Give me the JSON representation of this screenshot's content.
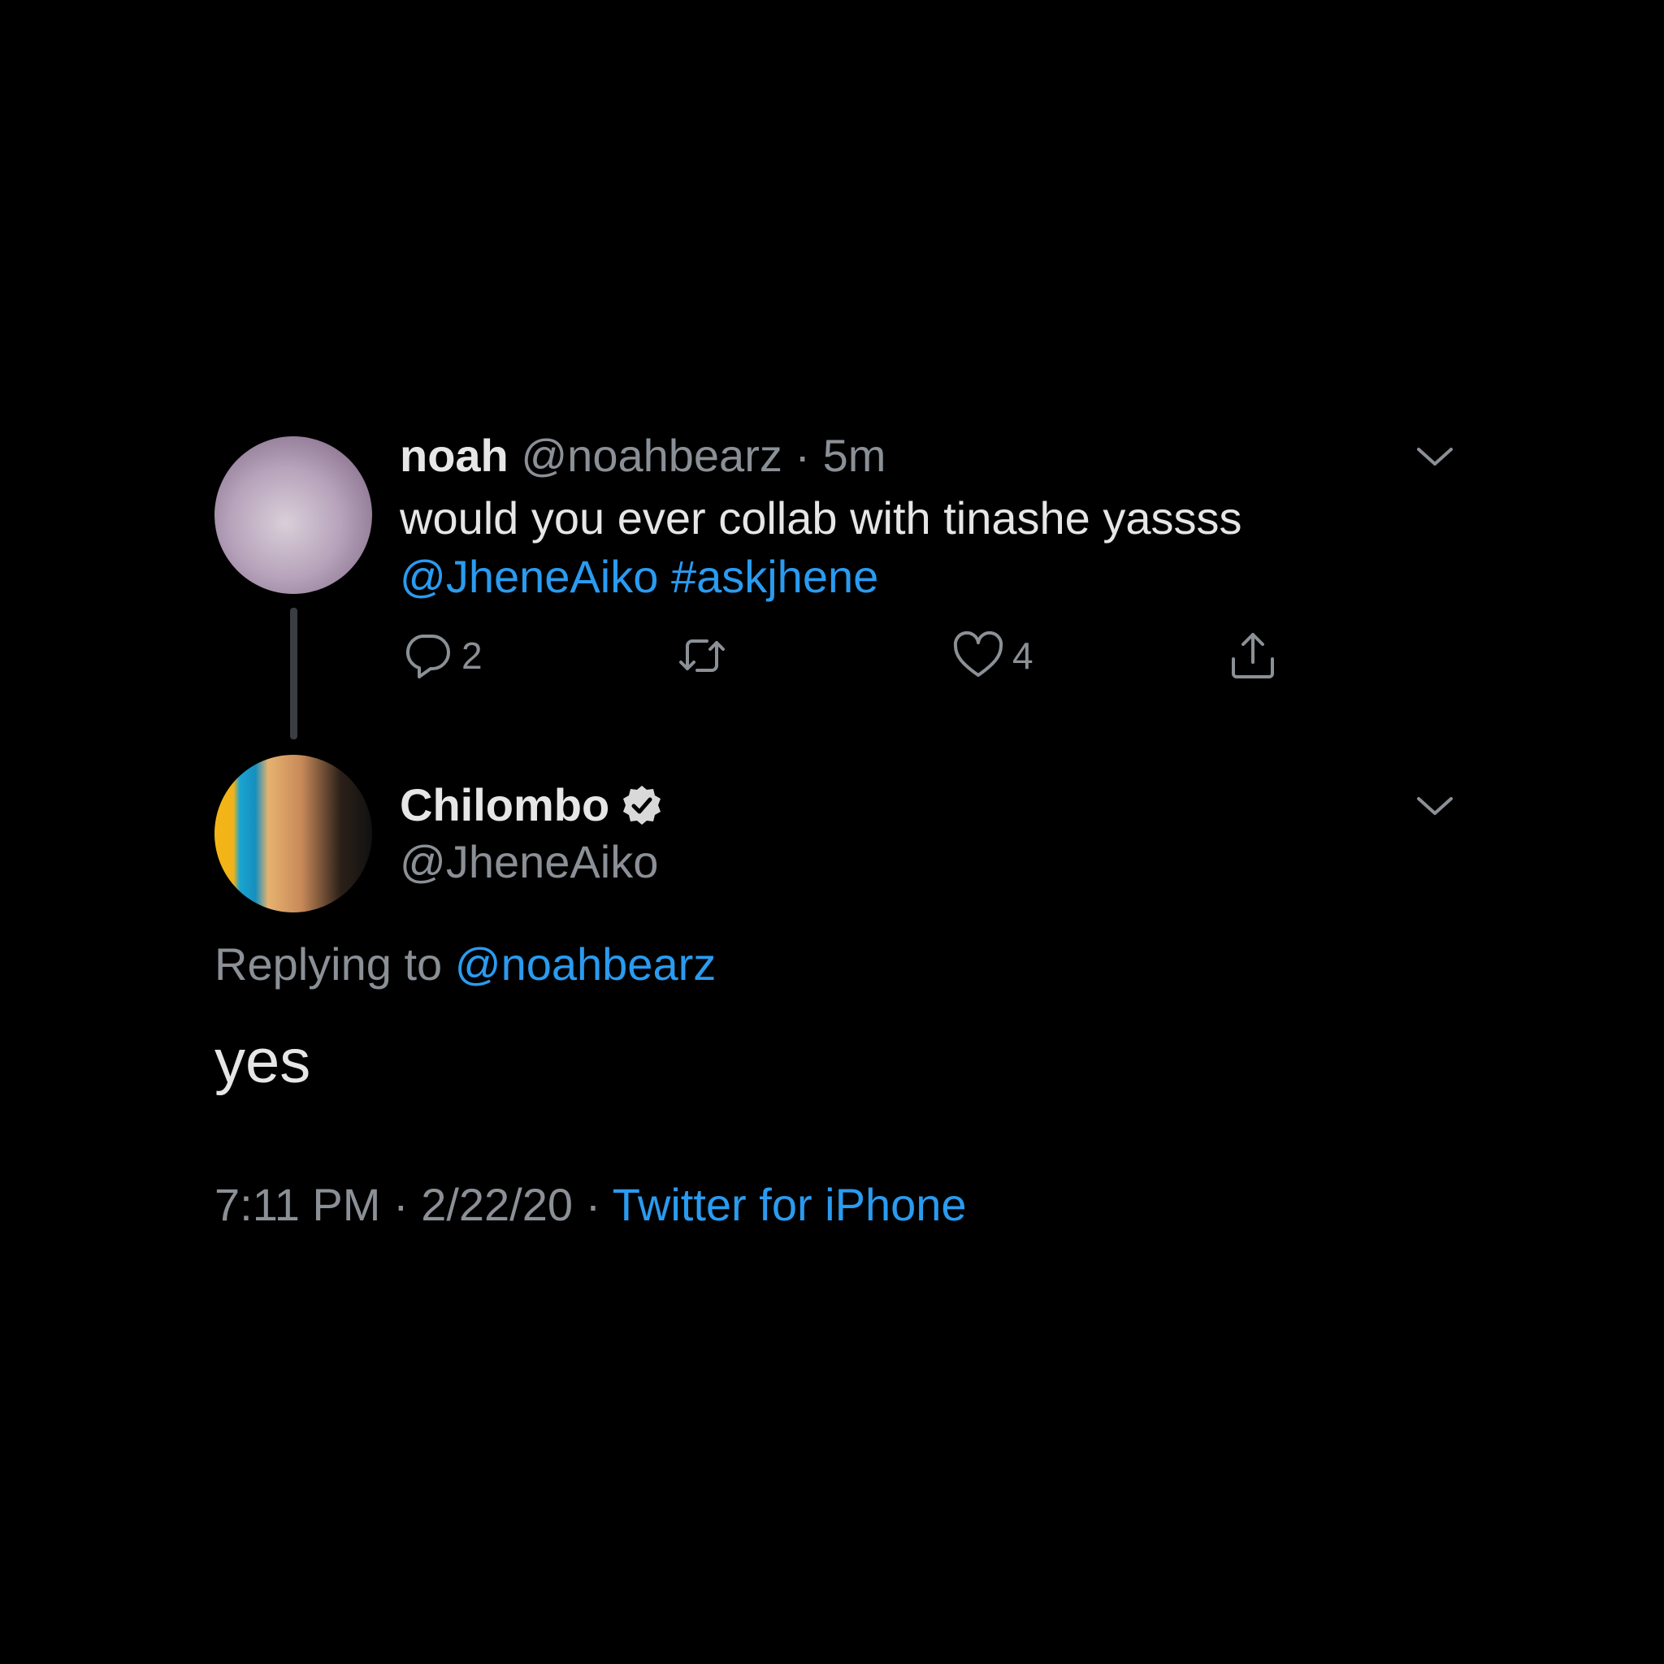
{
  "colors": {
    "background": "#000000",
    "text": "#e6e6e6",
    "muted": "#8b9096",
    "link": "#2a9bf0"
  },
  "tweet": {
    "author_name": "noah",
    "handle": "@noahbearz",
    "separator": "·",
    "time": "5m",
    "text": "would you ever collab with tinashe yassss",
    "mention": "@JheneAiko",
    "hashtag": "#askjhene",
    "actions": {
      "reply_icon": "reply-icon",
      "reply_count": "2",
      "retweet_icon": "retweet-icon",
      "like_icon": "heart-icon",
      "like_count": "4",
      "share_icon": "share-icon"
    },
    "menu_icon": "chevron-down-icon"
  },
  "reply": {
    "author_name": "Chilombo",
    "verified_icon": "verified-badge-icon",
    "handle": "@JheneAiko",
    "replying_to_label": "Replying to",
    "replying_to_handle": "@noahbearz",
    "text": "yes",
    "time": "7:11 PM",
    "separator": "·",
    "date": "2/22/20",
    "source": "Twitter for iPhone",
    "menu_icon": "chevron-down-icon"
  }
}
